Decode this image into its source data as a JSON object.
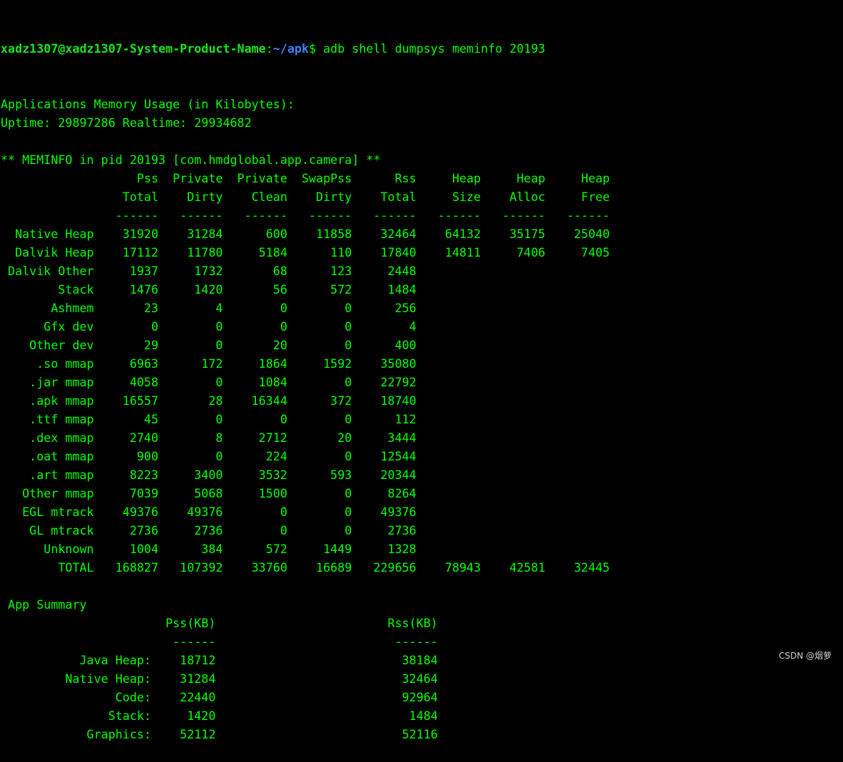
{
  "prompt": {
    "user_host": "xadz1307@xadz1307-System-Product-Name",
    "colon": ":",
    "path": "~/apk",
    "dollar": "$",
    "command": " adb shell dumpsys meminfo 20193"
  },
  "output_lines": [
    "Applications Memory Usage (in Kilobytes):",
    "Uptime: 29897286 Realtime: 29934682",
    "",
    "** MEMINFO in pid 20193 [com.hmdglobal.app.camera] **",
    "                   Pss  Private  Private  SwapPss      Rss     Heap     Heap     Heap",
    "                 Total    Dirty    Clean    Dirty    Total     Size    Alloc     Free",
    "                ------   ------   ------   ------   ------   ------   ------   ------",
    "  Native Heap    31920    31284      600    11858    32464    64132    35175    25040",
    "  Dalvik Heap    17112    11780     5184      110    17840    14811     7406     7405",
    " Dalvik Other     1937     1732       68      123     2448",
    "        Stack     1476     1420       56      572     1484",
    "       Ashmem       23        4        0        0      256",
    "      Gfx dev        0        0        0        0        4",
    "    Other dev       29        0       20        0      400",
    "     .so mmap     6963      172     1864     1592    35080",
    "    .jar mmap     4058        0     1084        0    22792",
    "    .apk mmap    16557       28    16344      372    18740",
    "    .ttf mmap       45        0        0        0      112",
    "    .dex mmap     2740        8     2712       20     3444",
    "    .oat mmap      900        0      224        0    12544",
    "    .art mmap     8223     3400     3532      593    20344",
    "   Other mmap     7039     5068     1500        0     8264",
    "   EGL mtrack    49376    49376        0        0    49376",
    "    GL mtrack     2736     2736        0        0     2736",
    "      Unknown     1004      384      572     1449     1328",
    "        TOTAL   168827   107392    33760    16689   229656    78943    42581    32445",
    "",
    " App Summary",
    "                       Pss(KB)                        Rss(KB)",
    "                        ------                         ------",
    "           Java Heap:    18712                          38184",
    "         Native Heap:    31284                          32464",
    "                Code:    22440                          92964",
    "               Stack:     1420                           1484",
    "            Graphics:    52112                          52116"
  ],
  "watermark": "CSDN @烟萝",
  "colors": {
    "background": "#000000",
    "text": "#00ff00",
    "prompt_user": "#19e619",
    "prompt_path": "#3b82f6"
  }
}
